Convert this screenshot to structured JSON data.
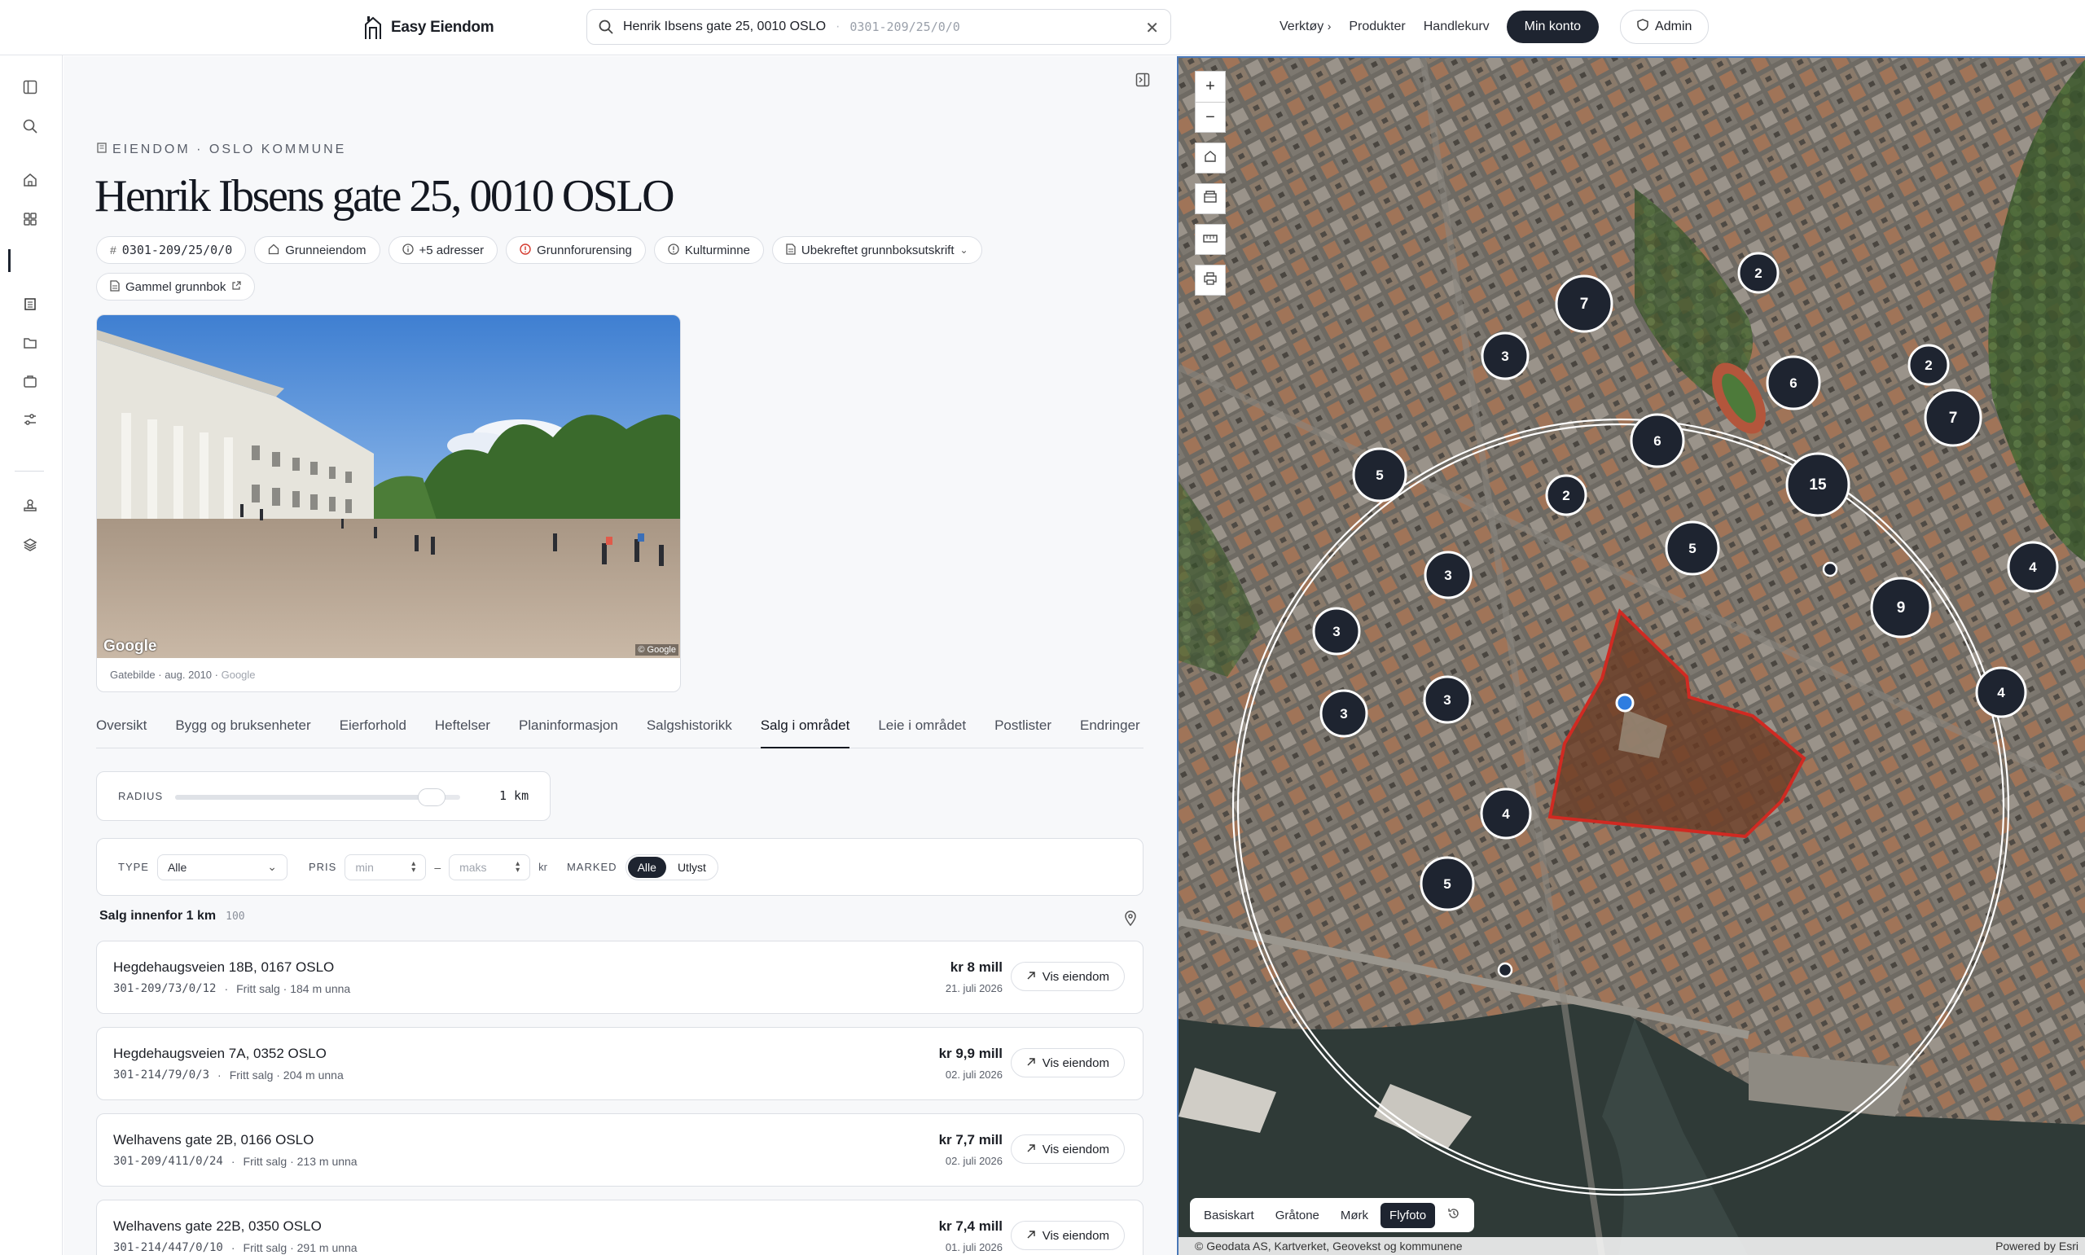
{
  "app": {
    "name": "Easy Eiendom"
  },
  "search": {
    "query": "Henrik Ibsens gate 25, 0010 OSLO",
    "separator": "·",
    "code": "0301-209/25/0/0"
  },
  "nav": {
    "tools": "Verktøy",
    "products": "Produkter",
    "cart": "Handlekurv",
    "account": "Min konto",
    "admin": "Admin"
  },
  "property": {
    "kicker": "EIENDOM · OSLO KOMMUNE",
    "title": "Henrik Ibsens gate 25, 0010 OSLO",
    "chips": {
      "matrikkel": "0301-209/25/0/0",
      "type": "Grunneiendom",
      "addresses": "+5 adresser",
      "pollution": "Grunnforurensing",
      "heritage": "Kulturminne",
      "extract": "Ubekreftet grunnboksutskrift",
      "old_registry": "Gammel grunnbok"
    },
    "photo_caption": "Gatebilde · aug. 2010 ·",
    "photo_source": "Google",
    "photo_logo": "Google",
    "photo_copyright": "© Google"
  },
  "tabs": [
    "Oversikt",
    "Bygg og bruksenheter",
    "Eierforhold",
    "Heftelser",
    "Planinformasjon",
    "Salgshistorikk",
    "Salg i området",
    "Leie i området",
    "Postlister",
    "Endringer"
  ],
  "active_tab": "Salg i området",
  "radius": {
    "label": "RADIUS",
    "value": "1 km",
    "fraction": 0.9
  },
  "filters": {
    "type_label": "TYPE",
    "type_value": "Alle",
    "price_label": "PRIS",
    "min_placeholder": "min",
    "max_placeholder": "maks",
    "dash": "–",
    "currency": "kr",
    "market_label": "MARKED",
    "market_options": [
      "Alle",
      "Utlyst"
    ],
    "market_selected": "Alle"
  },
  "list": {
    "heading": "Salg innenfor 1 km",
    "count": "100"
  },
  "sales": [
    {
      "address": "Hegdehaugsveien 18B, 0167 OSLO",
      "code": "301-209/73/0/12",
      "detail": "Fritt salg · 184 m unna",
      "price": "kr 8 mill",
      "date": "21. juli 2026",
      "action": "Vis eiendom"
    },
    {
      "address": "Hegdehaugsveien 7A, 0352 OSLO",
      "code": "301-214/79/0/3",
      "detail": "Fritt salg · 204 m unna",
      "price": "kr 9,9 mill",
      "date": "02. juli 2026",
      "action": "Vis eiendom"
    },
    {
      "address": "Welhavens gate 2B, 0166 OSLO",
      "code": "301-209/411/0/24",
      "detail": "Fritt salg · 213 m unna",
      "price": "kr 7,7 mill",
      "date": "02. juli 2026",
      "action": "Vis eiendom"
    },
    {
      "address": "Welhavens gate 22B, 0350 OSLO",
      "code": "301-214/447/0/10",
      "detail": "Fritt salg · 291 m unna",
      "price": "kr 7,4 mill",
      "date": "01. juli 2026",
      "action": "Vis eiendom"
    }
  ],
  "map": {
    "basemaps": [
      "Basiskart",
      "Gråtone",
      "Mørk",
      "Flyfoto"
    ],
    "selected_basemap": "Flyfoto",
    "attribution": "© Geodata AS, Kartverket, Geovekst og kommunene",
    "powered_by": "Powered by Esri",
    "clusters": [
      "7",
      "2",
      "3",
      "6",
      "2",
      "7",
      "6",
      "15",
      "5",
      "2",
      "5",
      "3",
      "4",
      "9",
      "3",
      "3",
      "3",
      "4",
      "4",
      "5"
    ],
    "colors": {
      "cluster": "#1e2430",
      "polygon": "#d02a22",
      "marker": "#2e7de0"
    }
  }
}
